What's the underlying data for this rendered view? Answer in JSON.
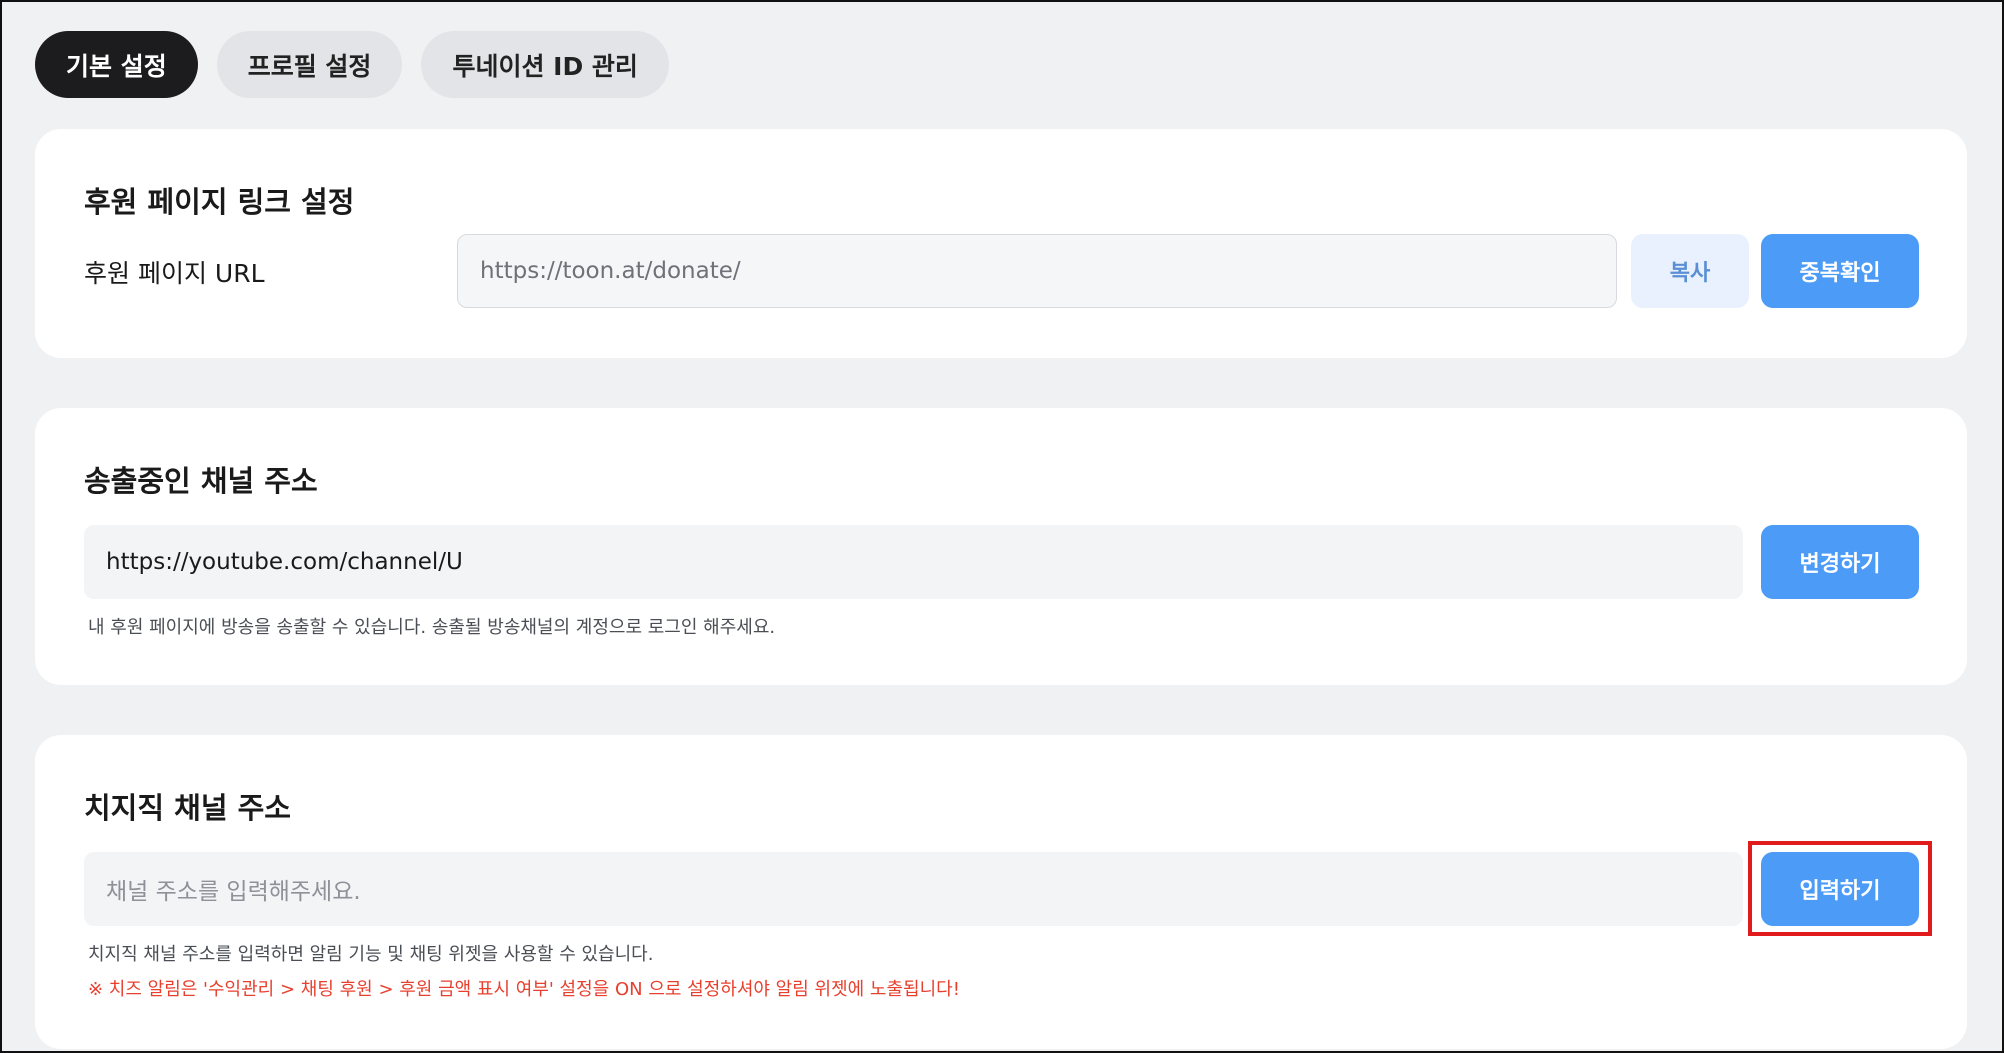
{
  "tabs": [
    {
      "label": "기본 설정",
      "active": true
    },
    {
      "label": "프로필 설정",
      "active": false
    },
    {
      "label": "투네이션 ID 관리",
      "active": false
    }
  ],
  "donate_link": {
    "title": "후원 페이지 링크 설정",
    "url_label": "후원 페이지 URL",
    "url_value": "https://toon.at/donate/",
    "copy_button": "복사",
    "check_button": "중복확인"
  },
  "broadcast_channel": {
    "title": "송출중인 채널 주소",
    "url_value": "https://youtube.com/channel/U",
    "change_button": "변경하기",
    "help": "내 후원 페이지에 방송을 송출할 수 있습니다. 송출될 방송채널의 계정으로 로그인 해주세요."
  },
  "chzzk_channel": {
    "title": "치지직 채널 주소",
    "placeholder": "채널 주소를 입력해주세요.",
    "submit_button": "입력하기",
    "help": "치지직 채널 주소를 입력하면 알림 기능 및 채팅 위젯을 사용할 수 있습니다.",
    "warning": "※ 치즈 알림은 '수익관리 > 채팅 후원 > 후원 금액 표시 여부' 설정을 ON 으로 설정하셔야 알림 위젯에 노출됩니다!"
  },
  "colors": {
    "primary_button": "#4c9cf7",
    "active_tab": "#1c1c1e",
    "warning_text": "#e8402f",
    "highlight_box": "#e11b1b"
  }
}
